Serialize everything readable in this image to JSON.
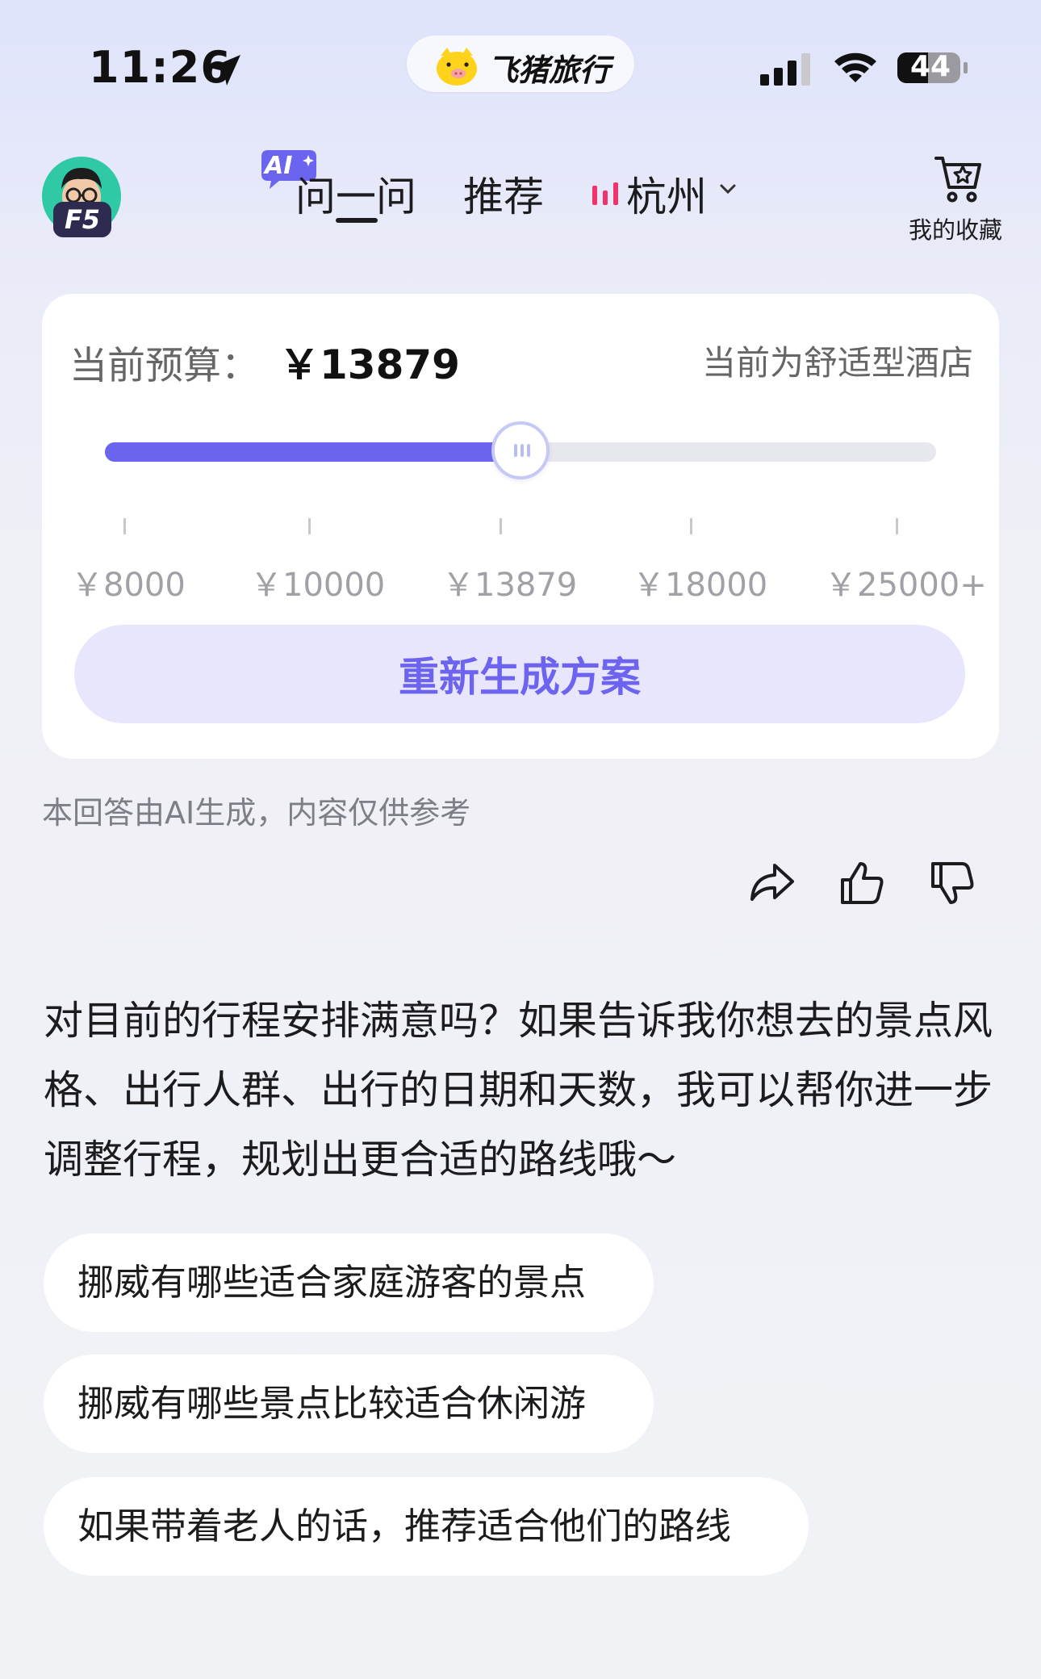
{
  "status_bar": {
    "time": "11:26",
    "app_pill_label": "飞猪旅行",
    "battery": "44",
    "icons": [
      "location-arrow-icon",
      "signal-icon",
      "wifi-icon",
      "battery-icon"
    ]
  },
  "header": {
    "avatar_badge": "F5",
    "ai_badge": "AI",
    "tabs": [
      {
        "label": "问一问",
        "active": true
      },
      {
        "label": "推荐",
        "active": false
      },
      {
        "label": "杭州",
        "active": false,
        "icon": "city-bars-icon",
        "dropdown": true
      }
    ],
    "favorites_label": "我的收藏"
  },
  "budget_card": {
    "label": "当前预算：",
    "value": "￥13879",
    "hotel_type": "当前为舒适型酒店",
    "slider_fraction": 0.5,
    "ticks": [
      "￥8000",
      "￥10000",
      "￥13879",
      "￥18000",
      "￥25000+"
    ],
    "regenerate_button": "重新生成方案",
    "accent_color": "#6b64ef"
  },
  "disclaimer": "本回答由AI生成，内容仅供参考",
  "actions": [
    "share-icon",
    "thumbs-up-icon",
    "thumbs-down-icon"
  ],
  "message": "对目前的行程安排满意吗？如果告诉我你想去的景点风格、出行人群、出行的日期和天数，我可以帮你进一步调整行程，规划出更合适的路线哦～",
  "suggestions": [
    "挪威有哪些适合家庭游客的景点",
    "挪威有哪些景点比较适合休闲游",
    "如果带着老人的话，推荐适合他们的路线"
  ]
}
